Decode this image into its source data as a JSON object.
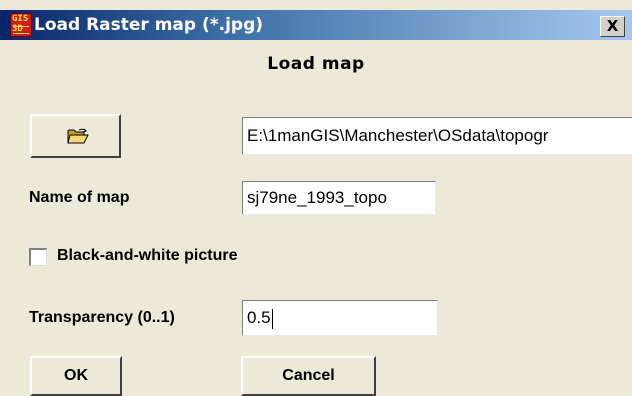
{
  "window": {
    "title": "Load Raster map (*.jpg)",
    "close_glyph": "X",
    "app_icon_text": "GIS3D",
    "app_icon": "gis-app-icon"
  },
  "dialog": {
    "heading": "Load map",
    "browse_icon": "open-folder-icon",
    "path_value": "E:\\1manGIS\\Manchester\\OSdata\\topogr",
    "name_label": "Name of map",
    "name_value": "sj79ne_1993_topo",
    "bw_label": "Black-and-white picture",
    "bw_checked": false,
    "transparency_label": "Transparency (0..1)",
    "transparency_value": "0.5",
    "ok_label": "OK",
    "cancel_label": "Cancel"
  },
  "colors": {
    "face": "#ece9d8",
    "title_start": "#08246b",
    "title_end": "#a6c8ee",
    "field_bg": "#ffffff"
  }
}
